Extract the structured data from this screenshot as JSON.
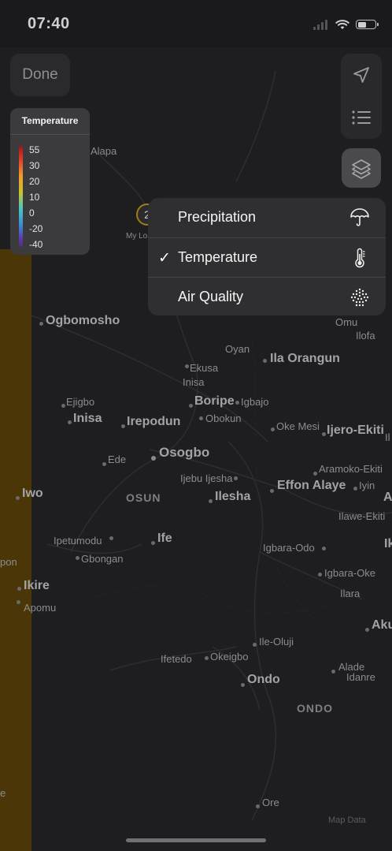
{
  "status_bar": {
    "time": "07:40"
  },
  "toolbar": {
    "done_label": "Done"
  },
  "icons": {
    "location": "location-arrow-icon",
    "list": "list-icon",
    "layers": "layers-icon",
    "precipitation": "umbrella-icon",
    "temperature": "thermometer-icon",
    "air_quality": "air-quality-dots-icon"
  },
  "legend": {
    "title": "Temperature",
    "values": [
      "55",
      "30",
      "20",
      "10",
      "0",
      "-20",
      "-40"
    ]
  },
  "my_location": {
    "badge": "2",
    "label": "My Lo"
  },
  "layer_menu": {
    "items": [
      {
        "label": "Precipitation",
        "checked": false
      },
      {
        "label": "Temperature",
        "checked": true,
        "check_mark": "✓"
      },
      {
        "label": "Air Quality",
        "checked": false
      }
    ]
  },
  "map": {
    "places": [
      {
        "name": "Alapa"
      },
      {
        "name": "Ogbomosho"
      },
      {
        "name": "Omu"
      },
      {
        "name": "Ilofa"
      },
      {
        "name": "Oyan"
      },
      {
        "name": "Ila Orangun"
      },
      {
        "name": "Ekusa"
      },
      {
        "name": "Inisa"
      },
      {
        "name": "Boripe"
      },
      {
        "name": "Igbajo"
      },
      {
        "name": "Ejigbo"
      },
      {
        "name": "Inisa"
      },
      {
        "name": "Irepodun"
      },
      {
        "name": "Obokun"
      },
      {
        "name": "Oke Mesi"
      },
      {
        "name": "Ijero-Ekiti"
      },
      {
        "name": "Ede"
      },
      {
        "name": "Osogbo"
      },
      {
        "name": "Aramoko-Ekiti"
      },
      {
        "name": "Ijebu Ijesha"
      },
      {
        "name": "Effon Alaye"
      },
      {
        "name": "Iyin"
      },
      {
        "name": "Iwo"
      },
      {
        "name": "OSUN"
      },
      {
        "name": "Ilesha"
      },
      {
        "name": "Ilawe-Ekiti"
      },
      {
        "name": "Ipetumodu"
      },
      {
        "name": "Ife"
      },
      {
        "name": "Igbara-Odo"
      },
      {
        "name": "Gbongan"
      },
      {
        "name": "pon"
      },
      {
        "name": "Igbara-Oke"
      },
      {
        "name": "Ikire"
      },
      {
        "name": "Ilara"
      },
      {
        "name": "Apomu"
      },
      {
        "name": "Aku"
      },
      {
        "name": "Ile-Oluji"
      },
      {
        "name": "Ifetedo"
      },
      {
        "name": "Okeigbo"
      },
      {
        "name": "Alade"
      },
      {
        "name": "Ondo"
      },
      {
        "name": "Idanre"
      },
      {
        "name": "ONDO"
      },
      {
        "name": "Ore"
      },
      {
        "name": "e"
      },
      {
        "name": "A"
      },
      {
        "name": "Ik"
      },
      {
        "name": "Il"
      }
    ],
    "attribution": "Map Data"
  }
}
